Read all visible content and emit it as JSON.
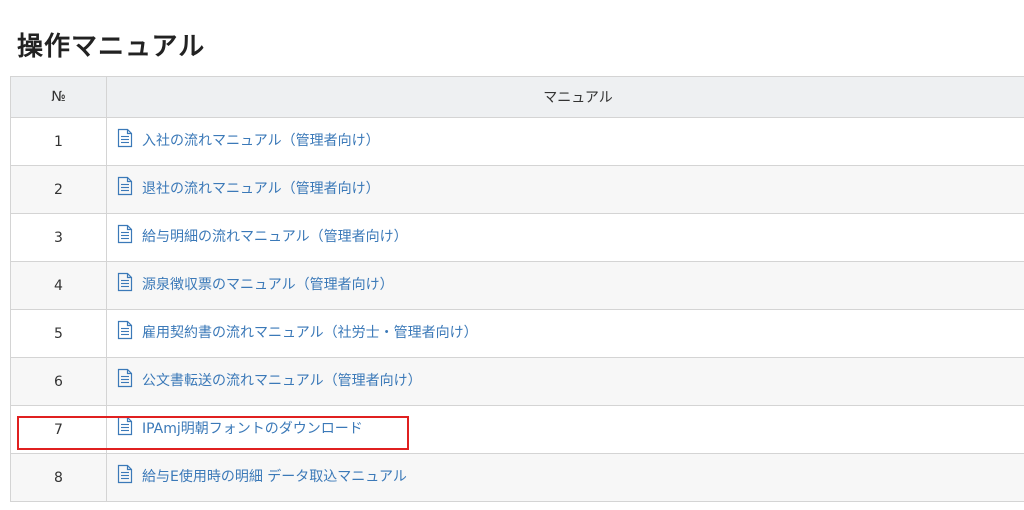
{
  "page": {
    "title": "操作マニュアル"
  },
  "table": {
    "headers": {
      "no": "№",
      "manual": "マニュアル"
    },
    "rows": [
      {
        "no": "1",
        "label": "入社の流れマニュアル（管理者向け）",
        "icon": "document-icon"
      },
      {
        "no": "2",
        "label": "退社の流れマニュアル（管理者向け）",
        "icon": "document-icon"
      },
      {
        "no": "3",
        "label": "給与明細の流れマニュアル（管理者向け）",
        "icon": "document-icon"
      },
      {
        "no": "4",
        "label": "源泉徴収票のマニュアル（管理者向け）",
        "icon": "document-icon"
      },
      {
        "no": "5",
        "label": "雇用契約書の流れマニュアル（社労士・管理者向け）",
        "icon": "document-icon"
      },
      {
        "no": "6",
        "label": "公文書転送の流れマニュアル（管理者向け）",
        "icon": "document-icon"
      },
      {
        "no": "7",
        "label": "IPAmj明朝フォントのダウンロード",
        "icon": "document-icon"
      },
      {
        "no": "8",
        "label": "給与E使用時の明細 データ取込マニュアル",
        "icon": "document-icon"
      }
    ]
  },
  "colors": {
    "link": "#3b79b8",
    "header_bg": "#eef0f2",
    "highlight": "#e02020"
  }
}
